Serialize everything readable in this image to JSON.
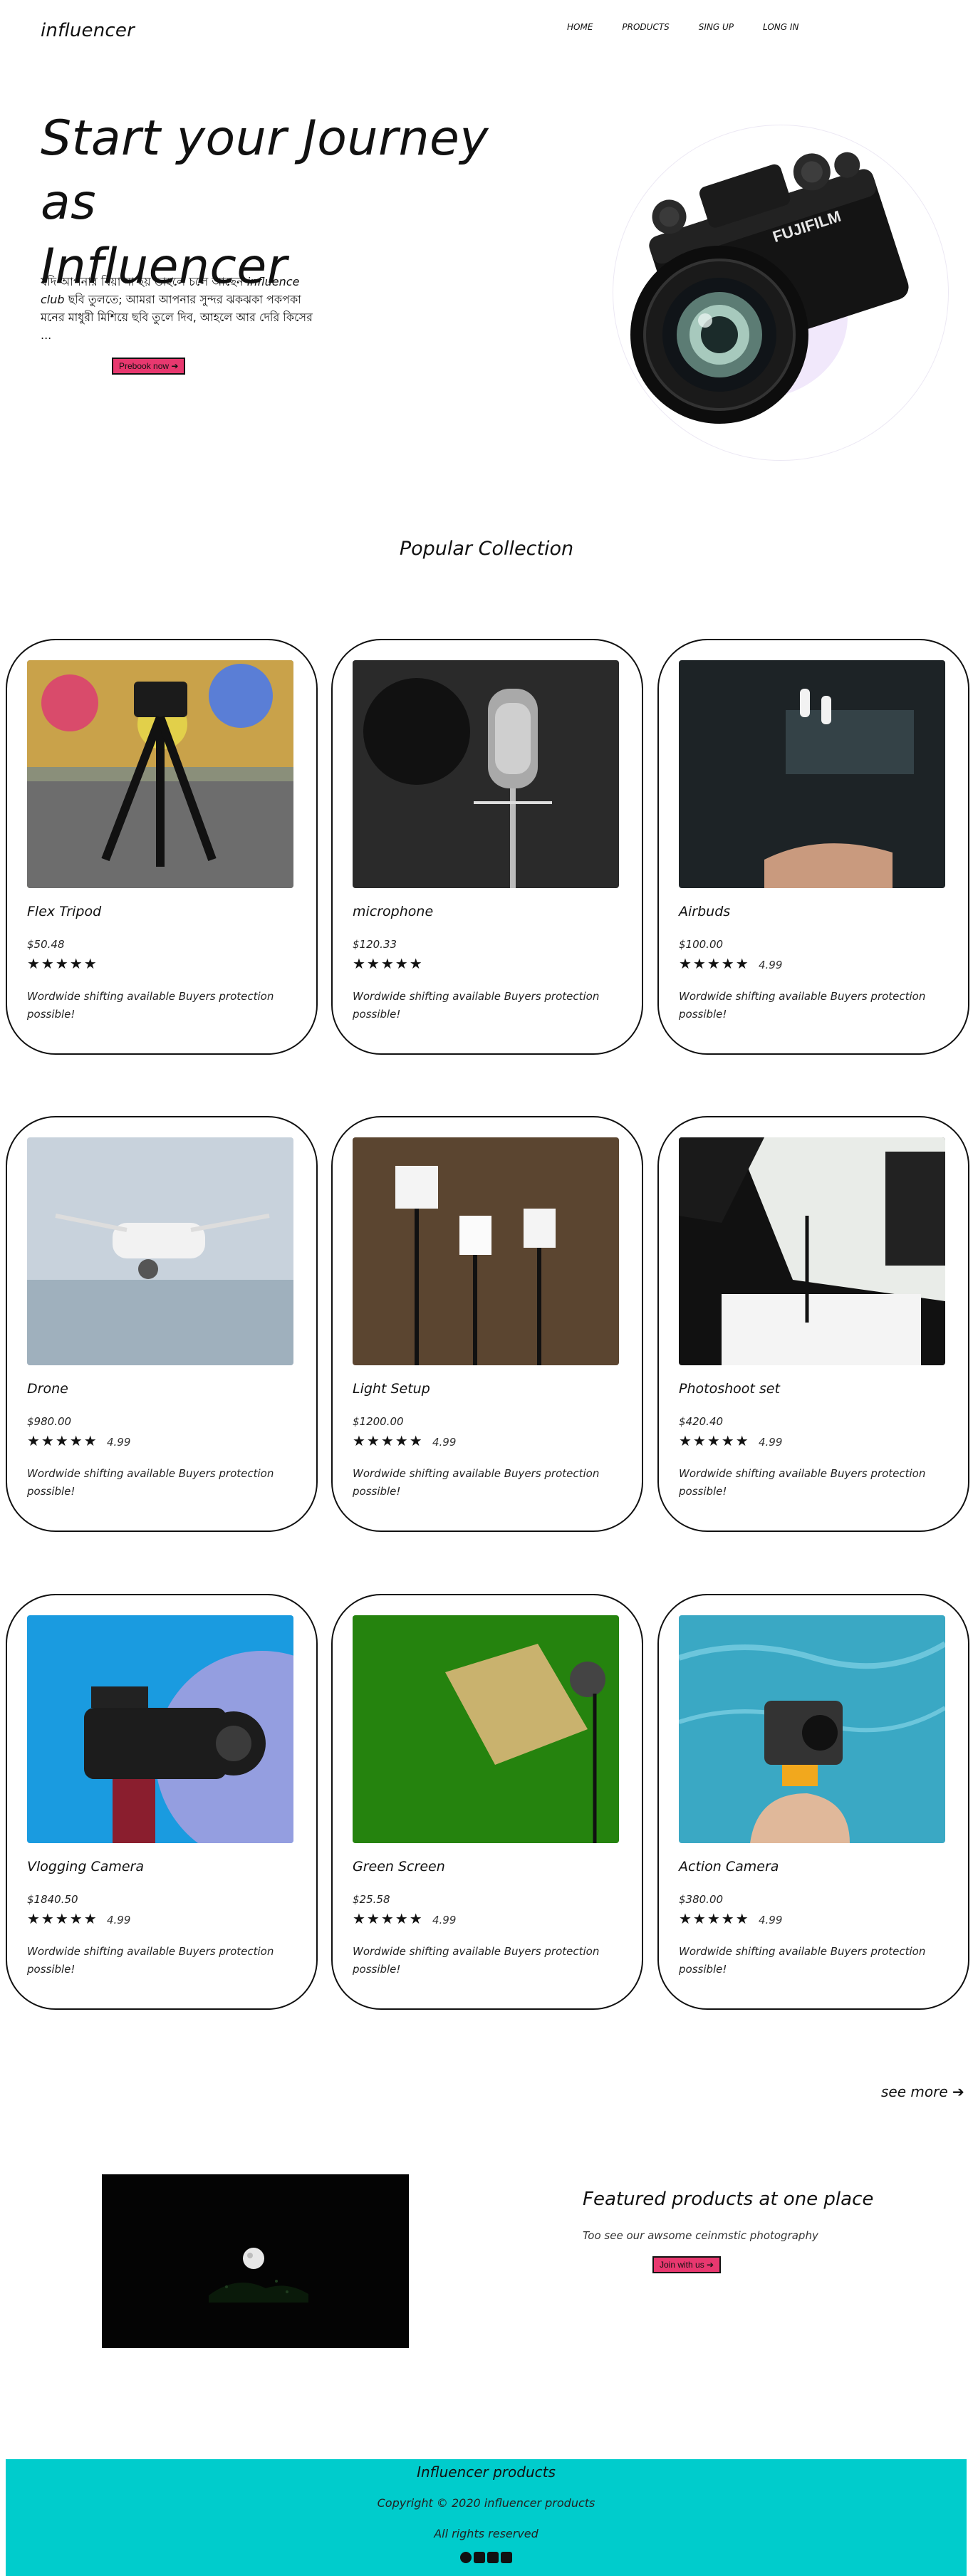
{
  "nav": {
    "logo": "influencer",
    "links": [
      "HOME",
      "PRODUCTS",
      "SING UP",
      "LONG IN"
    ]
  },
  "hero": {
    "title_line1": "Start your Journey as",
    "title_line2": "Influencer",
    "text_before": "যদি আপনার বিয়া না হয় তাহলে চলে আছেন",
    "text_italic": "influence club",
    "text_after": "ছবি তুলতে; আমরা আপনার সুন্দর ঝকঝকা পকপকা মনের মাধুরী মিশিয়ে ছবি তুলে দিব, আহলে আর দেরি কিসের ...",
    "button": "Prebook now ➔",
    "image_icon": "camera-icon"
  },
  "popular": {
    "title": "Popular Collection"
  },
  "products": [
    {
      "name": "Flex Tripod",
      "price": "$50.48",
      "stars": "★★★★★",
      "rating": "",
      "desc": "Wordwide shifting available Buyers protection possible!",
      "image": "tripod-photo"
    },
    {
      "name": "microphone",
      "price": "$120.33",
      "stars": "★★★★★",
      "rating": "",
      "desc": "Wordwide shifting available Buyers protection possible!",
      "image": "microphone-photo"
    },
    {
      "name": "Airbuds",
      "price": "$100.00",
      "stars": "★★★★★",
      "rating": "4.99",
      "desc": "Wordwide shifting available Buyers protection possible!",
      "image": "airbuds-photo"
    },
    {
      "name": "Drone",
      "price": "$980.00",
      "stars": "★★★★★",
      "rating": "4.99",
      "desc": "Wordwide shifting available Buyers protection possible!",
      "image": "drone-photo"
    },
    {
      "name": "Light Setup",
      "price": "$1200.00",
      "stars": "★★★★★",
      "rating": "4.99",
      "desc": "Wordwide shifting available Buyers protection possible!",
      "image": "light-setup-photo"
    },
    {
      "name": "Photoshoot set",
      "price": "$420.40",
      "stars": "★★★★★",
      "rating": "4.99",
      "desc": "Wordwide shifting available Buyers protection possible!",
      "image": "photoshoot-set-photo"
    },
    {
      "name": "Vlogging Camera",
      "price": "$1840.50",
      "stars": "★★★★★",
      "rating": "4.99",
      "desc": "Wordwide shifting available Buyers protection possible!",
      "image": "vlogging-camera-photo"
    },
    {
      "name": "Green Screen",
      "price": "$25.58",
      "stars": "★★★★★",
      "rating": "4.99",
      "desc": "Wordwide shifting available Buyers protection possible!",
      "image": "green-screen-photo"
    },
    {
      "name": "Action Camera",
      "price": "$380.00",
      "stars": "★★★★★",
      "rating": "4.99",
      "desc": "Wordwide shifting available Buyers protection possible!",
      "image": "action-camera-photo"
    }
  ],
  "see_more": "see more ➔",
  "featured": {
    "title": "Featured products at one place",
    "subtitle": "Too see our awsome ceinmstic photography",
    "button": "Join with us ➔"
  },
  "footer": {
    "title": "Influencer products",
    "copyright": "Copyright © 2020 influencer products",
    "rights": "All rights reserved",
    "socials": [
      "facebook-icon",
      "youtube-icon",
      "instagram-icon",
      "twitter-icon"
    ]
  },
  "colors": {
    "accent_pink": "#e8386f",
    "footer_teal": "#00cccc"
  }
}
